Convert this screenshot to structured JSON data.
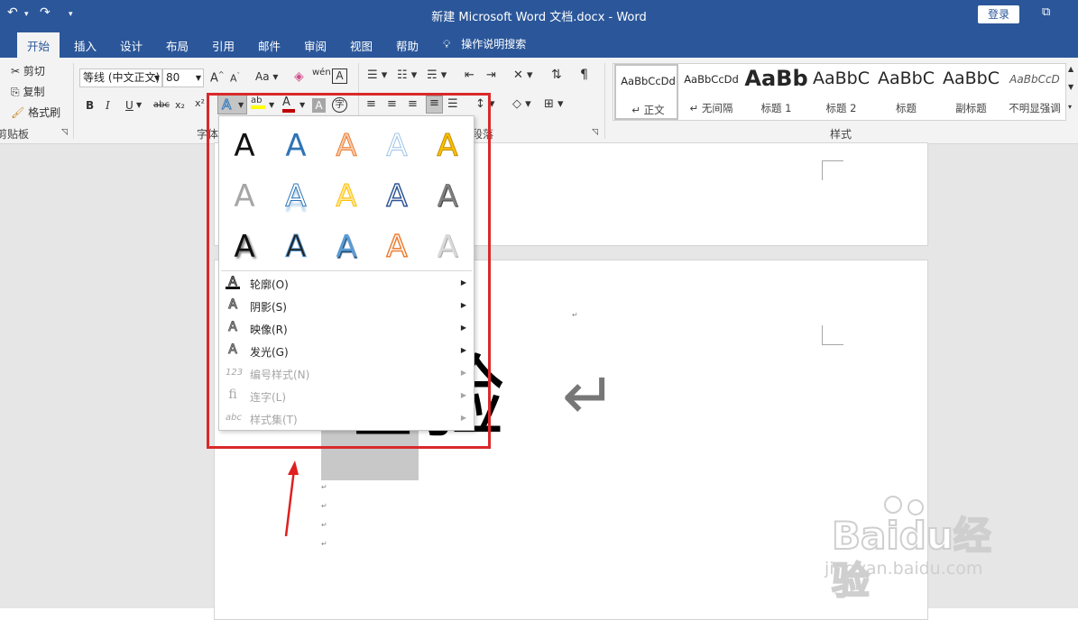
{
  "titlebar": {
    "title": "新建 Microsoft Word 文档.docx  -  Word",
    "login": "登录",
    "undo_icon": "↶",
    "redo_icon": "↷",
    "restore_icon": "⧉"
  },
  "tabs": [
    {
      "label": "开始"
    },
    {
      "label": "插入"
    },
    {
      "label": "设计"
    },
    {
      "label": "布局"
    },
    {
      "label": "引用"
    },
    {
      "label": "邮件"
    },
    {
      "label": "审阅"
    },
    {
      "label": "视图"
    },
    {
      "label": "帮助"
    }
  ],
  "tell_me": "操作说明搜索",
  "clipboard": {
    "cut": "剪切",
    "copy": "复制",
    "format_painter": "格式刷",
    "group_label": "剪贴板"
  },
  "font": {
    "name": "等线 (中文正文)",
    "size": "80",
    "group_label": "字体",
    "bold": "B",
    "italic": "I",
    "underline": "U",
    "strike": "abc",
    "subscript": "x₂",
    "superscript": "x²",
    "font_color": "#c00000",
    "highlight_color": "#ffff00"
  },
  "paragraph": {
    "group_label": "段落"
  },
  "styles": {
    "group_label": "样式",
    "items": [
      {
        "preview": "AaBbCcDd",
        "name": "↵ 正文",
        "selected": true
      },
      {
        "preview": "AaBbCcDd",
        "name": "↵ 无间隔"
      },
      {
        "preview": "AaBb",
        "name": "标题 1"
      },
      {
        "preview": "AaBbC",
        "name": "标题 2"
      },
      {
        "preview": "AaBbC",
        "name": "标题"
      },
      {
        "preview": "AaBbC",
        "name": "副标题"
      },
      {
        "preview": "AaBbCcD",
        "name": "不明显强调"
      }
    ]
  },
  "text_effects": {
    "gallery": [
      "A",
      "A",
      "A",
      "A",
      "A",
      "A",
      "A",
      "A",
      "A",
      "A",
      "A",
      "A",
      "A",
      "A",
      "A"
    ],
    "menu": [
      {
        "icon": "A",
        "label": "轮廓(O)",
        "enabled": true
      },
      {
        "icon": "A",
        "label": "阴影(S)",
        "enabled": true
      },
      {
        "icon": "A",
        "label": "映像(R)",
        "enabled": true
      },
      {
        "icon": "A",
        "label": "发光(G)",
        "enabled": true
      },
      {
        "icon": "123",
        "label": "编号样式(N)",
        "enabled": false
      },
      {
        "icon": "fi",
        "label": "连字(L)",
        "enabled": false
      },
      {
        "icon": "abc",
        "label": "样式集(T)",
        "enabled": false
      }
    ]
  },
  "document": {
    "big_text": "经验",
    "return_mark": "↵"
  },
  "watermark": {
    "brand": "Baidu经验",
    "url": "jingyan.baidu.com"
  }
}
